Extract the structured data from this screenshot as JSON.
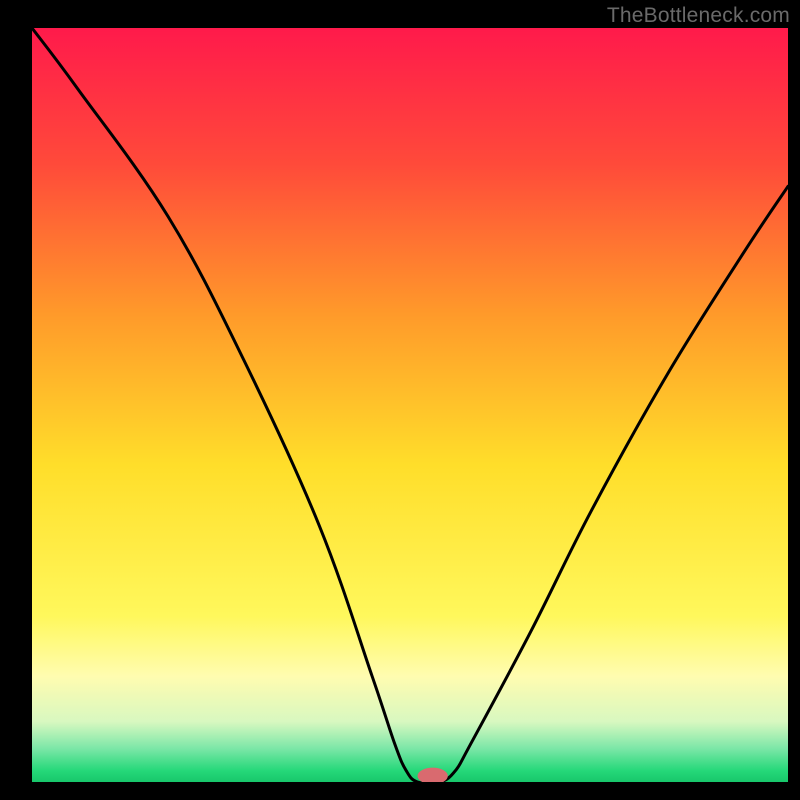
{
  "watermark": "TheBottleneck.com",
  "chart_data": {
    "type": "line",
    "title": "",
    "xlabel": "",
    "ylabel": "",
    "xlim": [
      0,
      100
    ],
    "ylim": [
      0,
      100
    ],
    "background_gradient": {
      "stops": [
        {
          "offset": 0.0,
          "color": "#ff1a4b"
        },
        {
          "offset": 0.18,
          "color": "#ff4a3a"
        },
        {
          "offset": 0.38,
          "color": "#ff9a2a"
        },
        {
          "offset": 0.58,
          "color": "#ffde2a"
        },
        {
          "offset": 0.78,
          "color": "#fff85c"
        },
        {
          "offset": 0.86,
          "color": "#fffcb0"
        },
        {
          "offset": 0.92,
          "color": "#d8f8c0"
        },
        {
          "offset": 0.955,
          "color": "#7de7a8"
        },
        {
          "offset": 0.985,
          "color": "#25d879"
        },
        {
          "offset": 1.0,
          "color": "#18c76b"
        }
      ]
    },
    "series": [
      {
        "name": "bottleneck-curve",
        "color": "#000000",
        "x": [
          0,
          6,
          18,
          28,
          38,
          45,
          48,
          49.5,
          51,
          54,
          56,
          58,
          66,
          74,
          84,
          94,
          100
        ],
        "y": [
          100,
          92,
          75,
          56,
          34,
          14,
          5,
          1.5,
          0,
          0,
          1.5,
          5,
          20,
          36,
          54,
          70,
          79
        ]
      }
    ],
    "marker": {
      "name": "optimal-point",
      "x": 53,
      "y": 0.8,
      "rx": 2.0,
      "ry": 1.1,
      "color": "#d96a6f"
    }
  }
}
